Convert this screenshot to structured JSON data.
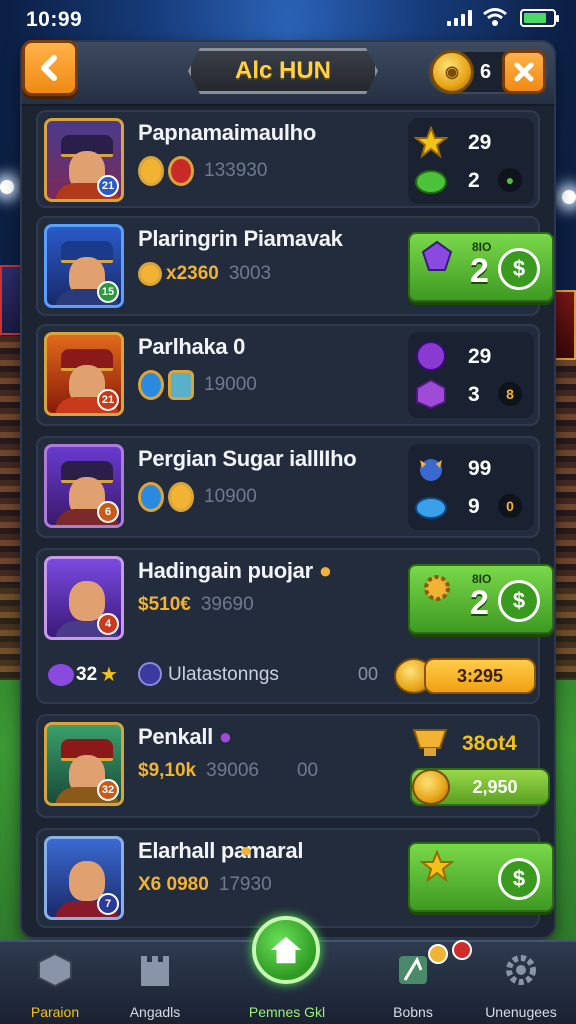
{
  "status_bar": {
    "time": "10:99"
  },
  "header": {
    "title": "Alc HUN",
    "coins": "6"
  },
  "rows": [
    {
      "name": "Papnamaimaulho",
      "sub_value": "133930",
      "stat1": "29",
      "stat2": "2",
      "mini": ""
    },
    {
      "name": "Plaringrin Piamavak",
      "sub_gold": "x2360",
      "sub_value": "3003",
      "btn_small": "8IO",
      "btn_big": "2",
      "btn_dollar": "$"
    },
    {
      "name": "Parlhaka   0",
      "sub_value": "19000",
      "stat1": "29",
      "stat2": "3",
      "mini": "8"
    },
    {
      "name": "Pergian Sugar iallIIho",
      "sub_value": "10900",
      "stat1": "99",
      "stat2": "9",
      "mini": "0"
    },
    {
      "name": "Hadingain puojar",
      "sub_gold": "$510€",
      "sub_value": "39690",
      "btn_small": "8IO",
      "btn_big": "2",
      "btn_dollar": "$",
      "extra": {
        "count": "32",
        "label": "Ulatastonngs",
        "mid": "00",
        "price": "3:295"
      }
    },
    {
      "name": "Penkall",
      "sub_gold": "$9,10k",
      "sub_value": "39006",
      "mid": "00",
      "stat1": "38ot4",
      "price": "2,950"
    },
    {
      "name": "Elarhall    pamaral",
      "sub_gold": "X6 0980",
      "sub_value": "17930",
      "btn_dollar": "$"
    }
  ],
  "bottom_nav": {
    "items": [
      {
        "label": "Paraion"
      },
      {
        "label": "Angadls"
      },
      {
        "label": "Pemnes Gkl"
      },
      {
        "label": "Bobns"
      },
      {
        "label": "Unenugees"
      }
    ]
  },
  "colors": {
    "accent_orange": "#f08a12",
    "accent_green": "#3e9a22",
    "gold": "#f2b233",
    "panel": "#1c2432"
  }
}
